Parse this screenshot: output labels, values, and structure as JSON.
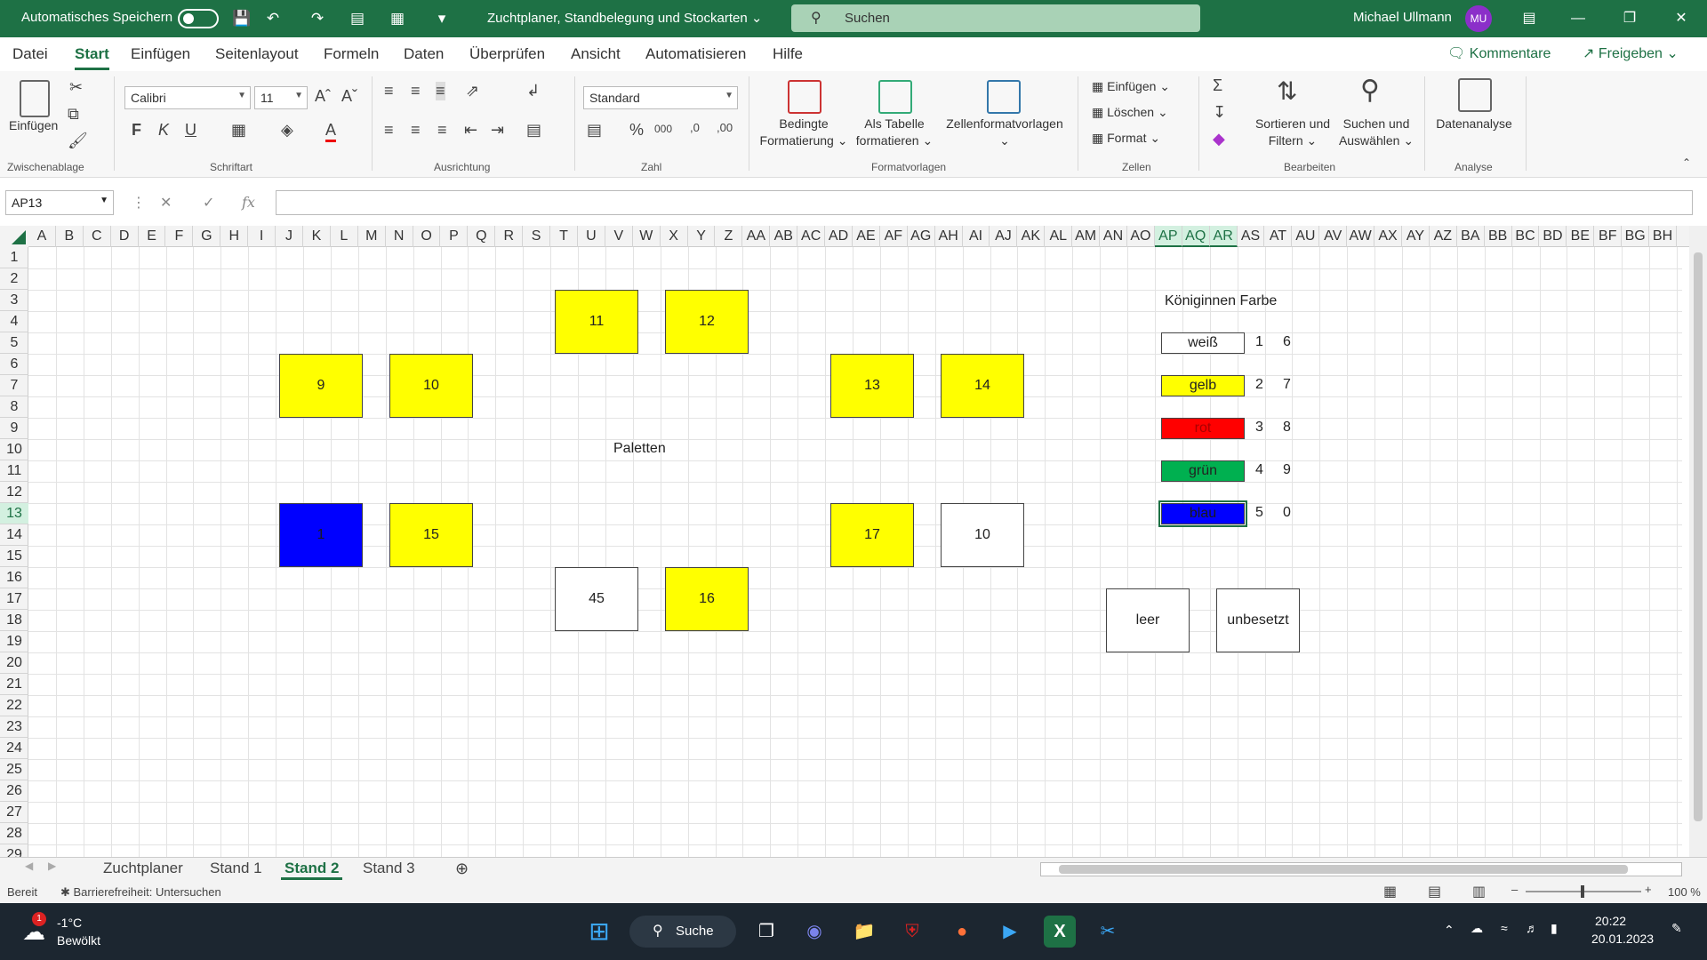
{
  "titlebar": {
    "autosave_label": "Automatisches Speichern",
    "doc_title": "Zuchtplaner, Standbelegung und Stockarten ⌄",
    "search_placeholder": "Suchen",
    "user_name": "Michael Ullmann",
    "user_initials": "MU"
  },
  "menu": {
    "items": [
      "Datei",
      "Start",
      "Einfügen",
      "Seitenlayout",
      "Formeln",
      "Daten",
      "Überprüfen",
      "Ansicht",
      "Automatisieren",
      "Hilfe"
    ],
    "comments": "Kommentare",
    "share": "Freigeben"
  },
  "ribbon": {
    "paste": "Einfügen",
    "clipboard_group": "Zwischenablage",
    "font_name": "Calibri",
    "font_size": "11",
    "bold": "F",
    "italic": "K",
    "underline": "U",
    "font_group": "Schriftart",
    "alignment_group": "Ausrichtung",
    "number_format": "Standard",
    "number_group": "Zahl",
    "conditional_1": "Bedingte",
    "conditional_2": "Formatierung",
    "as_table_1": "Als Tabelle",
    "as_table_2": "formatieren",
    "cell_styles": "Zellenformatvorlagen",
    "styles_group": "Formatvorlagen",
    "insert": "Einfügen",
    "delete": "Löschen",
    "format": "Format",
    "cells_group": "Zellen",
    "sort_1": "Sortieren und",
    "sort_2": "Filtern",
    "find_1": "Suchen und",
    "find_2": "Auswählen",
    "editing_group": "Bearbeiten",
    "data_analysis": "Datenanalyse",
    "analysis_group": "Analyse"
  },
  "formula": {
    "name_box": "AP13",
    "fx": "fx",
    "value": ""
  },
  "grid": {
    "columns": [
      "A",
      "B",
      "C",
      "D",
      "E",
      "F",
      "G",
      "H",
      "I",
      "J",
      "K",
      "L",
      "M",
      "N",
      "O",
      "P",
      "Q",
      "R",
      "S",
      "T",
      "U",
      "V",
      "W",
      "X",
      "Y",
      "Z",
      "AA",
      "AB",
      "AC",
      "AD",
      "AE",
      "AF",
      "AG",
      "AH",
      "AI",
      "AJ",
      "AK",
      "AL",
      "AM",
      "AN",
      "AO",
      "AP",
      "AQ",
      "AR",
      "AS",
      "AT",
      "AU",
      "AV",
      "AW",
      "AX",
      "AY",
      "AZ",
      "BA",
      "BB",
      "BC",
      "BD",
      "BE",
      "BF",
      "BG",
      "BH"
    ],
    "selected_columns": [
      "AP",
      "AQ",
      "AR"
    ],
    "rows": [
      "1",
      "2",
      "3",
      "4",
      "5",
      "6",
      "7",
      "8",
      "9",
      "10",
      "11",
      "12",
      "13",
      "14",
      "15",
      "16",
      "17",
      "18",
      "19",
      "20",
      "21",
      "22",
      "23",
      "24",
      "25",
      "26",
      "27",
      "28",
      "29"
    ],
    "selected_row": "13"
  },
  "sheet": {
    "boxes": {
      "b11": "11",
      "b12": "12",
      "b9": "9",
      "b10a": "10",
      "b13": "13",
      "b14": "14",
      "b1": "1",
      "b15": "15",
      "b17": "17",
      "b10b": "10",
      "b45": "45",
      "b16": "16"
    },
    "paletten": "Paletten",
    "legend": {
      "title": "Königinnen Farbe",
      "items": [
        {
          "label": "weiß",
          "a": "1",
          "b": "6",
          "color": "#ffffff"
        },
        {
          "label": "gelb",
          "a": "2",
          "b": "7",
          "color": "#ffff00"
        },
        {
          "label": "rot",
          "a": "3",
          "b": "8",
          "color": "#ff0000"
        },
        {
          "label": "grün",
          "a": "4",
          "b": "9",
          "color": "#00b050"
        },
        {
          "label": "blau",
          "a": "5",
          "b": "0",
          "color": "#0000ff"
        }
      ]
    },
    "empty_label": "leer",
    "unoccupied_label": "unbesetzt"
  },
  "tabs": {
    "items": [
      "Zuchtplaner",
      "Stand 1",
      "Stand 2",
      "Stand 3"
    ],
    "active": "Stand 2"
  },
  "status": {
    "ready": "Bereit",
    "accessibility": "Barrierefreiheit: Untersuchen",
    "zoom": "100 %"
  },
  "taskbar": {
    "weather_temp": "-1°C",
    "weather_desc": "Bewölkt",
    "weather_badge": "1",
    "search": "Suche",
    "time": "20:22",
    "date": "20.01.2023"
  },
  "colors": {
    "excel_green": "#1e7145",
    "yellow": "#ffff00",
    "blue": "#0000ff"
  }
}
